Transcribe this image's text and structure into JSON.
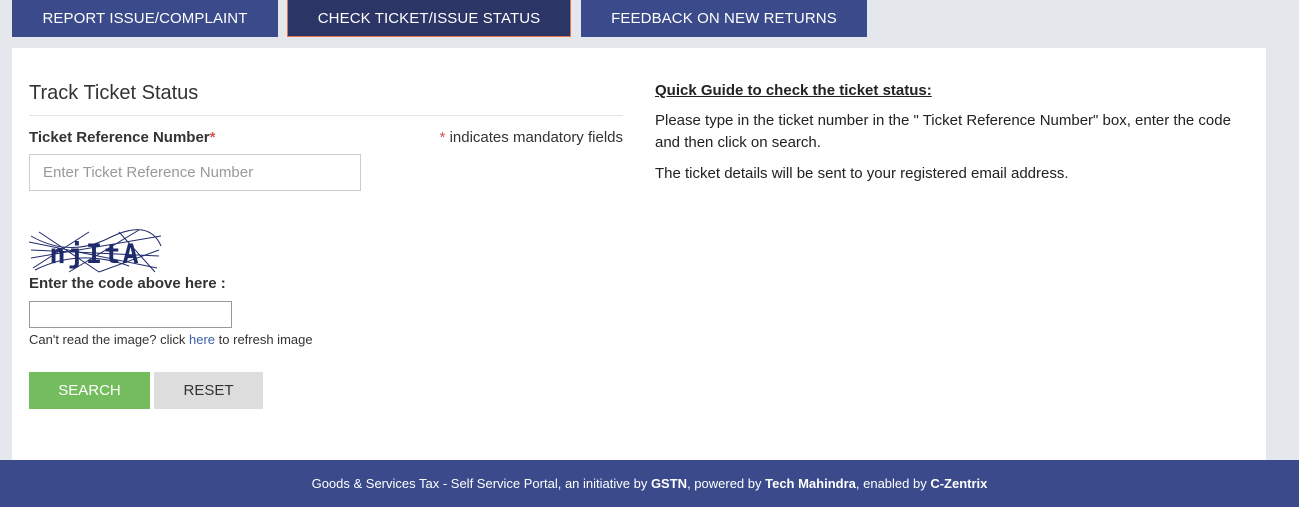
{
  "tabs": [
    {
      "label": "REPORT ISSUE/COMPLAINT"
    },
    {
      "label": "CHECK TICKET/ISSUE STATUS"
    },
    {
      "label": "FEEDBACK ON NEW RETURNS"
    }
  ],
  "form": {
    "title": "Track Ticket Status",
    "ticket_label": "Ticket Reference Number",
    "required_mark": "*",
    "mandatory_mark": "*",
    "mandatory_note": " indicates mandatory fields",
    "ticket_placeholder": "Enter Ticket Reference Number",
    "ticket_value": "",
    "captcha_text": "njItA",
    "captcha_label": "Enter the code above here :",
    "captcha_value": "",
    "refresh_prefix": "Can't read the image? click ",
    "refresh_link": "here",
    "refresh_suffix": " to refresh image",
    "search_label": "SEARCH",
    "reset_label": "RESET"
  },
  "guide": {
    "title": "Quick Guide to check the ticket status:",
    "p1": "Please type in the ticket number in the \" Ticket Reference Number\" box, enter the code and then click on search.",
    "p2": "The ticket details will be sent to your registered email address."
  },
  "footer": {
    "t1": "Goods & Services Tax - Self Service Portal, an initiative by ",
    "b1": "GSTN",
    "t2": ", powered by ",
    "b2": "Tech Mahindra",
    "t3": ", enabled by ",
    "b3": "C-Zentrix"
  }
}
